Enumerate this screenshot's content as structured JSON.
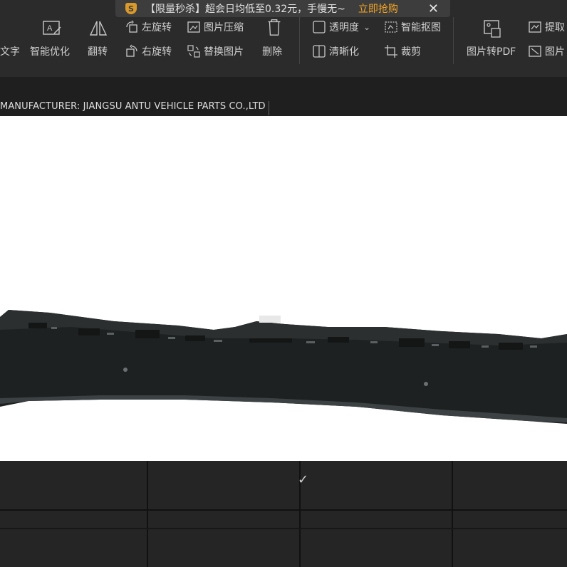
{
  "promo": {
    "text": "【限量秒杀】超会日均低至0.32元，手慢无~",
    "cta": "立即抢购",
    "close_glyph": "✕"
  },
  "toolbar": {
    "row1": [
      {
        "id": "smart-opt",
        "label": "",
        "icon": "ai-text-icon"
      },
      {
        "id": "flip",
        "label": "",
        "icon": "flip-icon"
      },
      {
        "id": "rotate-left",
        "label": "左旋转",
        "icon": "rotate-left-icon"
      },
      {
        "id": "compress",
        "label": "图片压缩",
        "icon": "compress-icon"
      },
      {
        "id": "delete",
        "label": "",
        "icon": "trash-icon"
      },
      {
        "id": "transparency",
        "label": "透明度",
        "icon": "transparency-icon"
      },
      {
        "id": "smart-cutout",
        "label": "智能抠图",
        "icon": "cutout-icon"
      },
      {
        "id": "img-to-pdf",
        "label": "",
        "icon": "image-pdf-icon"
      },
      {
        "id": "extract",
        "label": "提取",
        "icon": "extract-icon"
      }
    ],
    "row2": {
      "text_partial": "文字",
      "smart_opt": "智能优化",
      "flip": "翻转",
      "rotate_right": "右旋转",
      "replace_image": "替换图片",
      "delete": "删除",
      "clarity": "清晰化",
      "crop": "裁剪",
      "img_to_pdf": "图片转PDF",
      "image_partial": "图片"
    }
  },
  "document": {
    "manufacturer_line": "MANUFACTURER: JIANGSU ANTU VEHICLE PARTS CO.,LTD",
    "checkmark": "✓"
  },
  "colors": {
    "toolbar_bg": "#2b2b2b",
    "text": "#d6d6d6",
    "promo_bg": "#3a3a3a",
    "cta": "#f5a623",
    "doc_bg": "#1f1f1f"
  }
}
